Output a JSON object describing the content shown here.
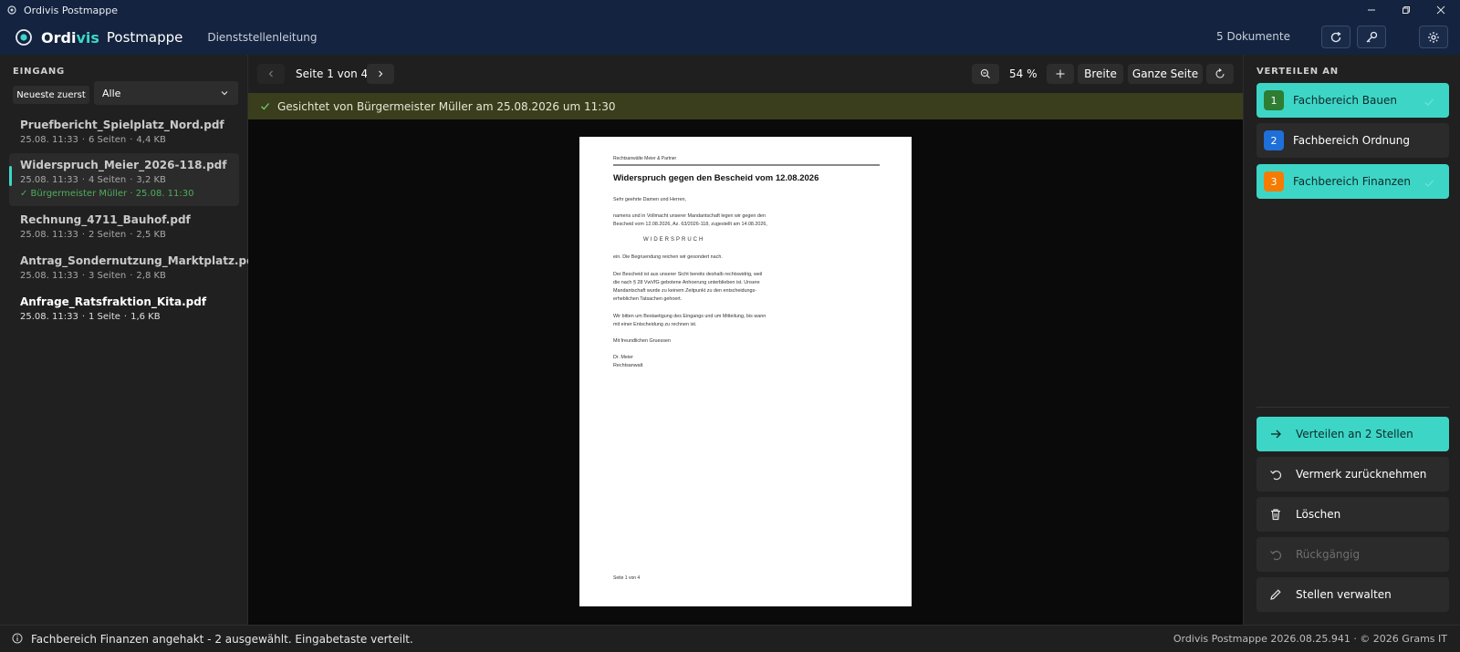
{
  "window": {
    "title": "Ordivis Postmappe"
  },
  "header": {
    "brand_main": "Ordi",
    "brand_accent": "vis",
    "product": "Postmappe",
    "role": "Dienststellenleitung",
    "doc_count": "5 Dokumente"
  },
  "sidebar": {
    "title": "EINGANG",
    "sort_label": "Neueste zuerst",
    "filter_value": "Alle",
    "documents": [
      {
        "name": "Pruefbericht_Spielplatz_Nord.pdf",
        "time": "25.08. 11:33",
        "pages": "6 Seiten",
        "size": "4,4 KB",
        "stamp": ""
      },
      {
        "name": "Widerspruch_Meier_2026-118.pdf",
        "time": "25.08. 11:33",
        "pages": "4 Seiten",
        "size": "3,2 KB",
        "stamp": "✓ Bürgermeister Müller · 25.08. 11:30"
      },
      {
        "name": "Rechnung_4711_Bauhof.pdf",
        "time": "25.08. 11:33",
        "pages": "2 Seiten",
        "size": "2,5 KB",
        "stamp": ""
      },
      {
        "name": "Antrag_Sondernutzung_Marktplatz.pdf",
        "time": "25.08. 11:33",
        "pages": "3 Seiten",
        "size": "2,8 KB",
        "stamp": ""
      },
      {
        "name": "Anfrage_Ratsfraktion_Kita.pdf",
        "time": "25.08. 11:33",
        "pages": "1 Seite",
        "size": "1,6 KB",
        "stamp": ""
      }
    ]
  },
  "viewer": {
    "page_info": "Seite 1 von 4",
    "zoom": "54 %",
    "fit_width_label": "Breite",
    "fit_page_label": "Ganze Seite",
    "banner_text": "Gesichtet von Bürgermeister Müller am 25.08.2026 um 11:30",
    "document": {
      "firm": "Rechtsanwälte Meier & Partner",
      "subject": "Widerspruch gegen den Bescheid vom 12.08.2026",
      "lines": [
        "Sehr geehrte Damen und Herren,",
        "namens und in Vollmacht unserer Mandantschaft legen wir gegen den",
        "Bescheid vom 12.08.2026, Az. 63/2026-118, zugestellt am 14.08.2026,",
        "ein. Die Begruendung reichen wir gesondert nach.",
        "Der Bescheid ist aus unserer Sicht bereits deshalb rechtswidrig, weil",
        "die nach § 28 VwVfG gebotene Anhoerung unterblieben ist. Unsere",
        "Mandantschaft wurde zu keinem Zeitpunkt zu den entscheidungs-",
        "erheblichen Tatsachen gehoert.",
        "Wir bitten um Bestaetigung des Eingangs und um Mitteilung, bis wann",
        "mit einer Entscheidung zu rechnen ist.",
        "Mit freundlichen Gruessen",
        "Dr. Meier",
        "Rechtsanwalt"
      ],
      "widerspruch": "WIDERSPRUCH",
      "footer": "Seite 1 von 4"
    }
  },
  "distribute": {
    "title": "VERTEILEN AN",
    "targets": [
      {
        "num": "1",
        "label": "Fachbereich Bauen",
        "checked": true,
        "color": "#2e7d32"
      },
      {
        "num": "2",
        "label": "Fachbereich Ordnung",
        "checked": false,
        "color": "#1e6fd9"
      },
      {
        "num": "3",
        "label": "Fachbereich Finanzen",
        "checked": true,
        "color": "#f57c00"
      }
    ],
    "actions": {
      "distribute": "Verteilen an 2 Stellen",
      "revoke": "Vermerk zurücknehmen",
      "delete": "Löschen",
      "undo": "Rückgängig",
      "manage": "Stellen verwalten"
    }
  },
  "status": {
    "message": "Fachbereich Finanzen angehakt - 2 ausgewählt. Eingabetaste verteilt.",
    "version": "Ordivis Postmappe 2026.08.25.941 · © 2026 Grams IT"
  },
  "colors": {
    "accent": "#3dd6c6",
    "titlebar": "#14233f",
    "banner": "#3b3e1c",
    "stamp_green": "#4fae5a"
  }
}
